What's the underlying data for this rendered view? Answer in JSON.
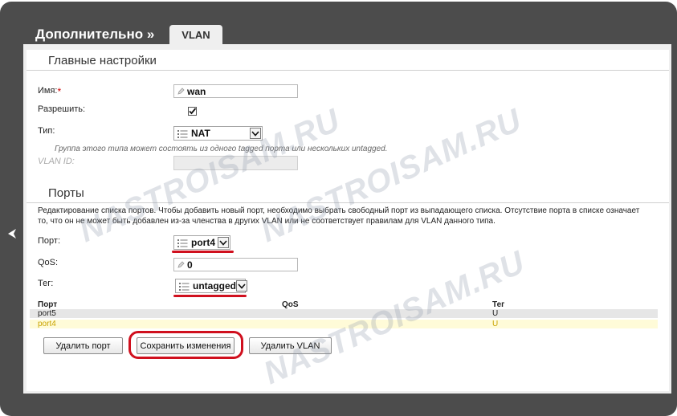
{
  "header": {
    "breadcrumb": "Дополнительно »",
    "tab_label": "VLAN"
  },
  "main_settings": {
    "title": "Главные настройки",
    "name_label": "Имя:",
    "name_required_mark": "*",
    "name_value": "wan",
    "enable_label": "Разрешить:",
    "enable_checked": true,
    "type_label": "Тип:",
    "type_value": "NAT",
    "type_hint": "Группа этого типа может состоять из одного tagged порта или нескольких untagged.",
    "vlan_id_label": "VLAN ID:",
    "vlan_id_value": ""
  },
  "ports": {
    "title": "Порты",
    "description": "Редактирование списка портов. Чтобы добавить новый порт, необходимо выбрать свободный порт из выпадающего списка. Отсутствие порта в списке означает то, что он не может быть добавлен из-за членства в других VLAN или не соответствует правилам для VLAN данного типа.",
    "port_label": "Порт:",
    "port_value": "port4",
    "qos_label": "QoS:",
    "qos_value": "0",
    "tag_label": "Тег:",
    "tag_value": "untagged",
    "table": {
      "headers": [
        "Порт",
        "QoS",
        "Тег"
      ],
      "rows": [
        {
          "port": "port5",
          "qos": "",
          "tag": "U"
        },
        {
          "port": "port4",
          "qos": "",
          "tag": "U"
        }
      ]
    }
  },
  "buttons": {
    "delete_port": "Удалить порт",
    "save": "Сохранить изменения",
    "delete_vlan": "Удалить VLAN"
  },
  "watermark": "NASTROISAM.RU",
  "colors": {
    "frame": "#4c4c4c",
    "panel": "#efefef",
    "highlight_row": "#fffbd8",
    "highlight_text": "#c9a300",
    "annotation_red": "#d0101e"
  }
}
